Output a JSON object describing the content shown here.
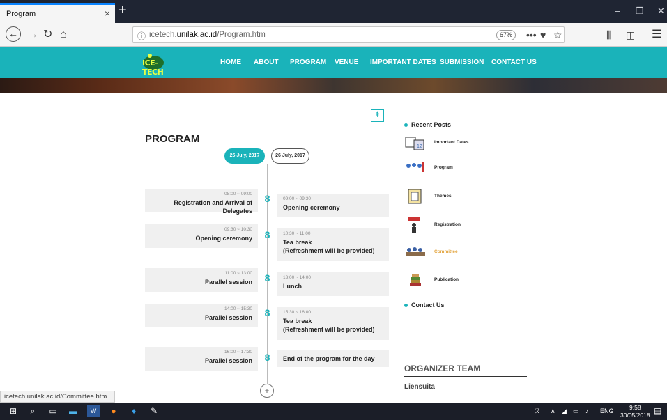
{
  "browser": {
    "tab_title": "Program",
    "tab_close": "×",
    "new_tab": "+",
    "url_prefix": "icetech.",
    "url_domain": "unilak.ac.id",
    "url_path": "/Program.htm",
    "zoom": "67%",
    "status_url": "icetech.unilak.ac.id/Committee.htm"
  },
  "site": {
    "logo_text": "ICE-TECH",
    "menu": [
      "HOME",
      "ABOUT",
      "PROGRAM",
      "VENUE",
      "IMPORTANT DATES",
      "SUBMISSION",
      "CONTACT US"
    ]
  },
  "program": {
    "title": "PROGRAM",
    "dates": [
      "25 July, 2017",
      "26 July, 2017"
    ],
    "left": [
      {
        "time": "08:00 ~ 09:00",
        "event": "Registration and Arrival of Delegates"
      },
      {
        "time": "09:30 ~ 10:30",
        "event": "Opening ceremony"
      },
      {
        "time": "11:00 ~ 13:00",
        "event": "Parallel session"
      },
      {
        "time": "14:00 ~ 15:30",
        "event": "Parallel session"
      },
      {
        "time": "16:00 ~ 17:30",
        "event": "Parallel session"
      }
    ],
    "right": [
      {
        "time": "09:00 ~ 09:30",
        "event": "Opening ceremony"
      },
      {
        "time": "10:30 ~ 11:00",
        "event": "Tea break",
        "event2": "(Refreshment will be provided)"
      },
      {
        "time": "13:00 ~ 14:00",
        "event": "Lunch"
      },
      {
        "time": "15:30 ~ 16:00",
        "event": "Tea break",
        "event2": "(Refreshment will be provided)"
      },
      {
        "time": "",
        "event": "End of the program for the day"
      }
    ]
  },
  "sidebar": {
    "recent_posts": "Recent Posts",
    "posts": [
      "Important Dates",
      "Program",
      "Themes",
      "Registration",
      "Committee",
      "Publication"
    ],
    "contact": "Contact Us",
    "organizer_title": "ORGANIZER TEAM",
    "organizer_name": "Liensuita"
  },
  "taskbar": {
    "lang": "ENG",
    "time": "9:58",
    "date": "30/05/2018"
  },
  "colors": {
    "accent": "#1ab3ba",
    "highlight": "#e2a33b"
  }
}
